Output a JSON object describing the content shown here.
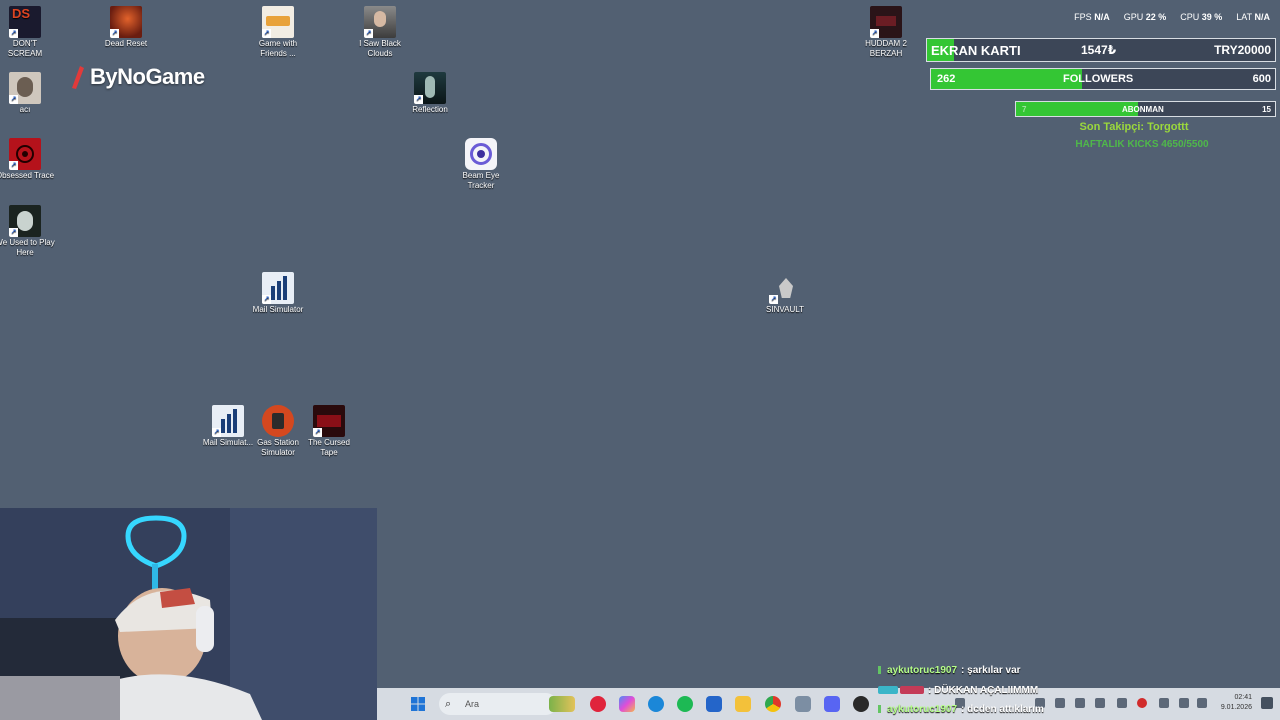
{
  "desktop_icons": [
    {
      "id": "dont-scream",
      "label": "DON'T SCREAM",
      "icon": "dont-scream-icon"
    },
    {
      "id": "dead-reset",
      "label": "Dead Reset",
      "icon": "dead-reset-icon"
    },
    {
      "id": "game-with-friends",
      "label": "Game with Friends ...",
      "icon": "game-with-friends-icon"
    },
    {
      "id": "i-saw-black-clouds",
      "label": "I Saw Black Clouds",
      "icon": "i-saw-black-clouds-icon"
    },
    {
      "id": "huddam",
      "label": "HUDDAM 2 BERZAH",
      "icon": "huddam-icon"
    },
    {
      "id": "aci",
      "label": "acı",
      "icon": "aci-icon"
    },
    {
      "id": "reflection",
      "label": "Reflection",
      "icon": "reflection-icon"
    },
    {
      "id": "obsessed-trace",
      "label": "Obsessed Trace",
      "icon": "obsessed-trace-icon"
    },
    {
      "id": "beam-eye-tracker",
      "label": "Beam Eye Tracker",
      "icon": "beam-eye-tracker-icon"
    },
    {
      "id": "we-used-to-play-here",
      "label": "We Used to Play Here",
      "icon": "we-used-to-play-here-icon"
    },
    {
      "id": "mail-simulator",
      "label": "Mail Simulator",
      "icon": "mail-simulator-icon"
    },
    {
      "id": "sinvault",
      "label": "SINVAULT",
      "icon": "sinvault-icon"
    },
    {
      "id": "mail-simulat-2",
      "label": "Mail Simulat...",
      "icon": "mail-simulator-icon"
    },
    {
      "id": "gas-station",
      "label": "Gas Station Simulator",
      "icon": "gas-station-icon"
    },
    {
      "id": "cursed-tape",
      "label": "The Cursed Tape",
      "icon": "cursed-tape-icon"
    }
  ],
  "logo": {
    "text": "ByNoGame"
  },
  "stats": {
    "fps_label": "FPS",
    "fps_value": "N/A",
    "gpu_label": "GPU",
    "gpu_value": "22 %",
    "cpu_label": "CPU",
    "cpu_value": "39 %",
    "lat_label": "LAT",
    "lat_value": "N/A"
  },
  "goals": {
    "ekran": {
      "title": "EKRAN KARTI",
      "current": "1547₺",
      "target": "TRY20000",
      "progress": 0.077
    },
    "followers": {
      "current": "262",
      "title": "FOLLOWERS",
      "target": "600",
      "progress": 0.44
    },
    "abonman": {
      "current": "7",
      "title": "ABONMAN",
      "target": "15",
      "progress": 0.47
    }
  },
  "last_follower": "Son Takipçi: Torgottt",
  "weekly_kicks": "HAFTALIK KICKS 4650/5500",
  "colors": {
    "desktop": "#526072",
    "goal_fill": "#34c634",
    "accent_green": "#9bd83c",
    "chat_user": "#b6ff8a"
  },
  "chat": [
    {
      "user": "aykutoruc1907",
      "message": ": şarkılar var"
    },
    {
      "user": "",
      "message": ": DÜKKAN AÇALIIMMM"
    },
    {
      "user": "aykutoruc1907",
      "message": ": dcden attıklarım"
    }
  ],
  "taskbar": {
    "search_placeholder": "Ara",
    "time": "02:41",
    "date": "9.01.2026"
  }
}
